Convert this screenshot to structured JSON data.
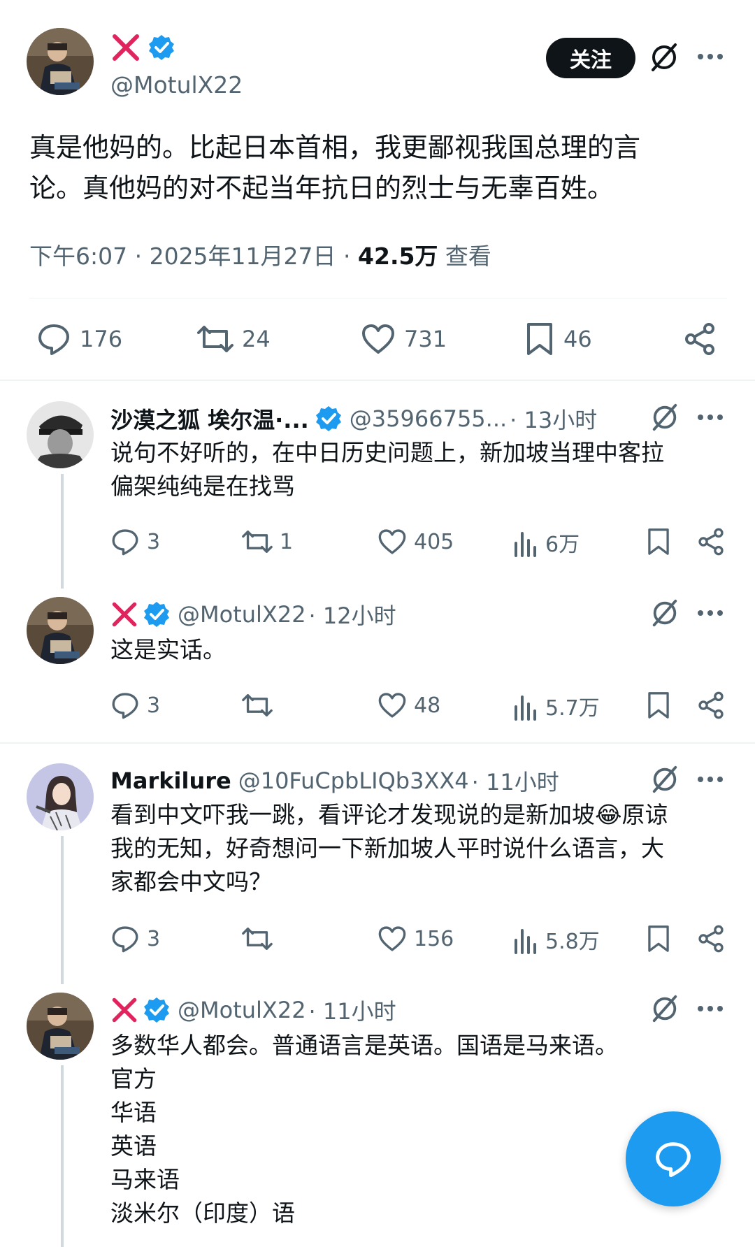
{
  "main_tweet": {
    "author_handle": "@MotulX22",
    "follow_label": "关注",
    "text_line1": "真是他妈的。比起日本首相，我更鄙视我国总理的言",
    "text_line2": "论。真他妈的对不起当年抗日的烈士与无辜百姓。",
    "time": "下午6:07 · 2025年11月27日 · ",
    "views": "42.5万",
    "views_label": " 查看",
    "replies": "176",
    "retweets": "24",
    "likes": "731",
    "bookmarks": "46"
  },
  "replies": [
    {
      "name": "沙漠之狐 埃尔温·...",
      "handle": "@35966755...",
      "time": " · 13小时",
      "text_lines": [
        "说句不好听的，在中日历史问题上，新加坡当理中客拉",
        "偏架纯纯是在找骂"
      ],
      "replies": "3",
      "retweets": "1",
      "likes": "405",
      "views": "6万"
    },
    {
      "name": "",
      "handle": "@MotulX22",
      "time": " · 12小时",
      "text_lines": [
        "这是实话。"
      ],
      "replies": "3",
      "retweets": "",
      "likes": "48",
      "views": "5.7万"
    },
    {
      "name": "Markilure",
      "handle": "@10FuCpbLIQb3XX4",
      "time": " · 11小时",
      "text_lines": [
        "看到中文吓我一跳，看评论才发现说的是新加坡😂原谅",
        "我的无知，好奇想问一下新加坡人平时说什么语言，大",
        "家都会中文吗？"
      ],
      "replies": "3",
      "retweets": "",
      "likes": "156",
      "views": "5.8万"
    },
    {
      "name": "",
      "handle": "@MotulX22",
      "time": " · 11小时",
      "text_lines": [
        "多数华人都会。普通语言是英语。国语是马来语。",
        "官方",
        "华语",
        "英语",
        "马来语",
        "淡米尔（印度）语"
      ]
    }
  ],
  "colors": {
    "accent": "#1d9bf0",
    "text": "#0f1419",
    "secondary": "#536471",
    "x_red": "#e0245e"
  }
}
